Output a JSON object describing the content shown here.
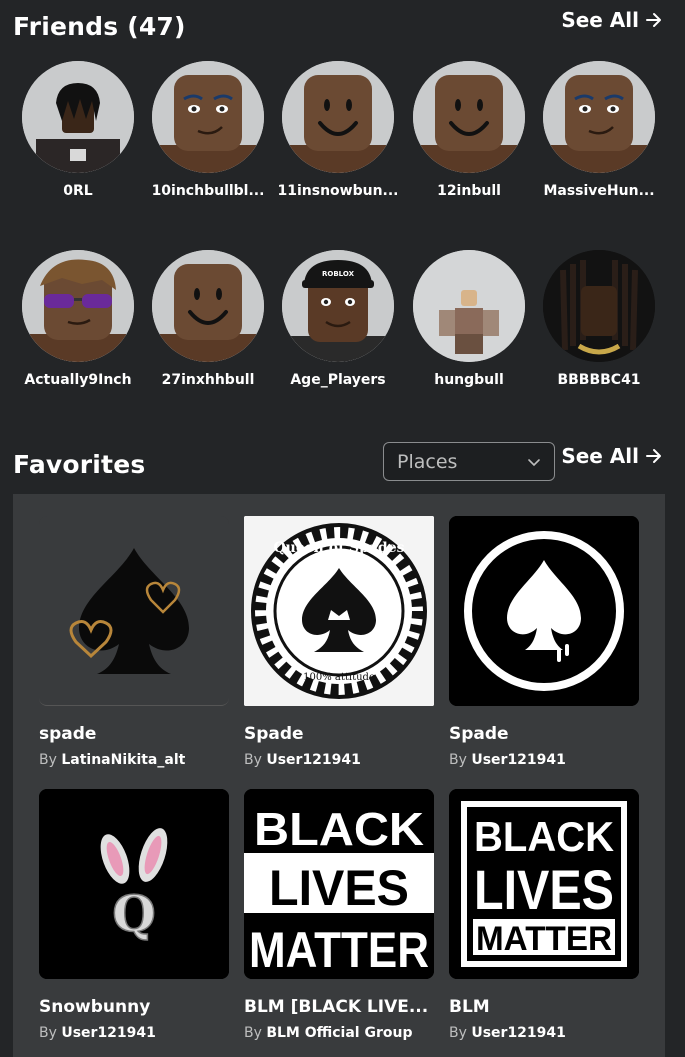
{
  "friends": {
    "title": "Friends (47)",
    "see_all": "See All",
    "items": [
      {
        "name": "0RL",
        "icon": "avatar-dreads-icon"
      },
      {
        "name": "10inchbullbl...",
        "icon": "avatar-face-icon"
      },
      {
        "name": "11insnowbun...",
        "icon": "avatar-smile-icon"
      },
      {
        "name": "12inbull",
        "icon": "avatar-smile-icon"
      },
      {
        "name": "MassiveHun...",
        "icon": "avatar-face-icon"
      },
      {
        "name": "Actually9Inch",
        "icon": "avatar-glasses-icon"
      },
      {
        "name": "27inxhhbull",
        "icon": "avatar-smile-icon"
      },
      {
        "name": "Age_Players",
        "icon": "avatar-cap-icon"
      },
      {
        "name": "hungbull",
        "icon": "avatar-fullbody-icon"
      },
      {
        "name": "BBBBBC41",
        "icon": "avatar-dreads-icon"
      }
    ]
  },
  "favorites": {
    "title": "Favorites",
    "filter_selected": "Places",
    "see_all": "See All",
    "by_label": "By",
    "items": [
      {
        "name": "spade",
        "creator": "LatinaNikita_alt",
        "icon": "spade-hearts-icon"
      },
      {
        "name": "Spade",
        "creator": "User121941",
        "icon": "queen-of-spades-icon"
      },
      {
        "name": "Spade",
        "creator": "User121941",
        "icon": "spade-circle-icon"
      },
      {
        "name": "Snowbunny",
        "creator": "User121941",
        "icon": "bunny-q-icon"
      },
      {
        "name": "BLM [BLACK LIVE...",
        "creator": "BLM Official Group",
        "icon": "blm-icon"
      },
      {
        "name": "BLM",
        "creator": "User121941",
        "icon": "blm-icon"
      }
    ],
    "logo_text": {
      "queen_of_spades": "Queen of Spades",
      "attitude": "100% attitude",
      "blm_line1": "BLACK",
      "blm_line2": "LIVES",
      "blm_line3": "MATTER",
      "cap": "ROBLOX",
      "q": "Q"
    }
  },
  "colors": {
    "background": "#232527",
    "panel": "#393b3d",
    "text": "#ffffff",
    "muted": "#bdbebe",
    "skin": "#6b4a33",
    "avatar_bg": "#c9cbcc"
  }
}
